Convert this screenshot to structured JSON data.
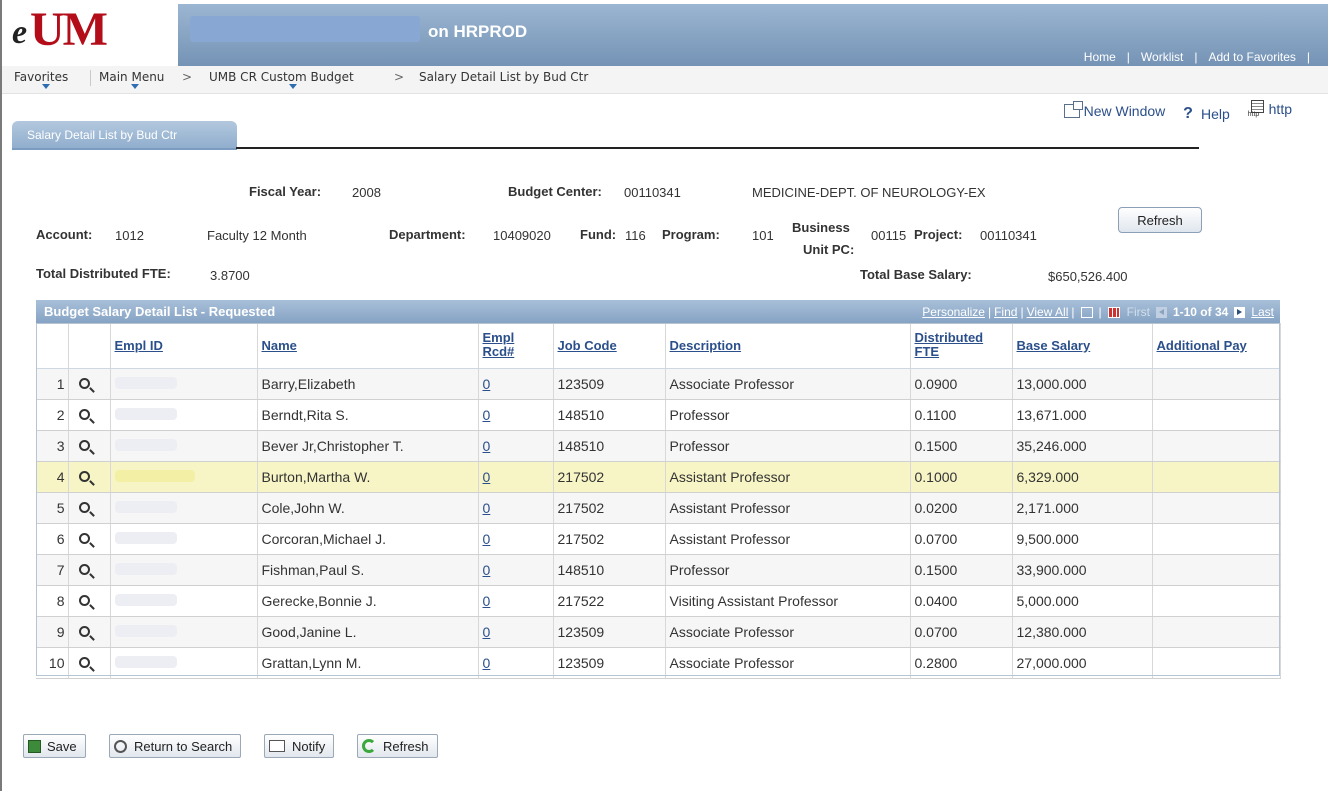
{
  "header": {
    "logo_text": "eUM",
    "server": "on HRPROD",
    "links": {
      "home": "Home",
      "worklist": "Worklist",
      "favorites": "Add to Favorites"
    }
  },
  "breadcrumb": {
    "favorites": "Favorites",
    "main_menu": "Main Menu",
    "custom_budget": "UMB CR Custom Budget",
    "current": "Salary Detail List by Bud Ctr",
    "separator": ">"
  },
  "utils": {
    "new_window": "New Window",
    "help": "Help",
    "http": "http"
  },
  "tab": {
    "label": "Salary Detail List by Bud Ctr"
  },
  "info": {
    "fiscal_year_label": "Fiscal Year:",
    "fiscal_year": "2008",
    "budget_center_label": "Budget Center:",
    "budget_center": "00110341",
    "budget_center_desc": "MEDICINE-DEPT. OF NEUROLOGY-EX",
    "account_label": "Account:",
    "account": "1012",
    "account_desc": "Faculty 12 Month",
    "department_label": "Department:",
    "department": "10409020",
    "fund_label": "Fund:",
    "fund": "116",
    "program_label": "Program:",
    "program": "101",
    "business_unit_label_1": "Business",
    "business_unit_label_2": "Unit PC:",
    "business_unit": "00115",
    "project_label": "Project:",
    "project": "00110341",
    "refresh": "Refresh",
    "total_fte_label": "Total Distributed FTE:",
    "total_fte": "3.8700",
    "total_salary_label": "Total Base Salary:",
    "total_salary": "$650,526.400"
  },
  "grid": {
    "title": "Budget Salary Detail List - Requested",
    "nav": {
      "personalize": "Personalize",
      "find": "Find",
      "view_all": "View All",
      "first": "First",
      "range": "1-10 of 34",
      "last": "Last"
    },
    "columns": {
      "empl_id": "Empl ID",
      "name": "Name",
      "empl_rcd_1": "Empl",
      "empl_rcd_2": "Rcd#",
      "job_code": "Job Code",
      "description": "Description",
      "fte_1": "Distributed",
      "fte_2": "FTE",
      "base_salary": "Base Salary",
      "additional_pay": "Additional Pay"
    },
    "rows": [
      {
        "num": "1",
        "name": "Barry,Elizabeth",
        "rcd": "0",
        "job": "123509",
        "desc": "Associate Professor",
        "fte": "0.0900",
        "salary": "13,000.000",
        "add": ""
      },
      {
        "num": "2",
        "name": "Berndt,Rita S.",
        "rcd": "0",
        "job": "148510",
        "desc": "Professor",
        "fte": "0.1100",
        "salary": "13,671.000",
        "add": ""
      },
      {
        "num": "3",
        "name": "Bever Jr,Christopher T.",
        "rcd": "0",
        "job": "148510",
        "desc": "Professor",
        "fte": "0.1500",
        "salary": "35,246.000",
        "add": ""
      },
      {
        "num": "4",
        "name": "Burton,Martha W.",
        "rcd": "0",
        "job": "217502",
        "desc": "Assistant Professor",
        "fte": "0.1000",
        "salary": "6,329.000",
        "add": ""
      },
      {
        "num": "5",
        "name": "Cole,John W.",
        "rcd": "0",
        "job": "217502",
        "desc": "Assistant Professor",
        "fte": "0.0200",
        "salary": "2,171.000",
        "add": ""
      },
      {
        "num": "6",
        "name": "Corcoran,Michael J.",
        "rcd": "0",
        "job": "217502",
        "desc": "Assistant Professor",
        "fte": "0.0700",
        "salary": "9,500.000",
        "add": ""
      },
      {
        "num": "7",
        "name": "Fishman,Paul S.",
        "rcd": "0",
        "job": "148510",
        "desc": "Professor",
        "fte": "0.1500",
        "salary": "33,900.000",
        "add": ""
      },
      {
        "num": "8",
        "name": "Gerecke,Bonnie J.",
        "rcd": "0",
        "job": "217522",
        "desc": "Visiting Assistant Professor",
        "fte": "0.0400",
        "salary": "5,000.000",
        "add": ""
      },
      {
        "num": "9",
        "name": "Good,Janine L.",
        "rcd": "0",
        "job": "123509",
        "desc": "Associate Professor",
        "fte": "0.0700",
        "salary": "12,380.000",
        "add": ""
      },
      {
        "num": "10",
        "name": "Grattan,Lynn M.",
        "rcd": "0",
        "job": "123509",
        "desc": "Associate Professor",
        "fte": "0.2800",
        "salary": "27,000.000",
        "add": ""
      }
    ],
    "highlight_color": "#f7f5c6"
  },
  "toolbar": {
    "save": "Save",
    "return": "Return to Search",
    "notify": "Notify",
    "refresh": "Refresh"
  },
  "colors": {
    "brand_red": "#b20d19",
    "banner_blue": "#7593b5",
    "link_blue": "#2b4f8a"
  }
}
